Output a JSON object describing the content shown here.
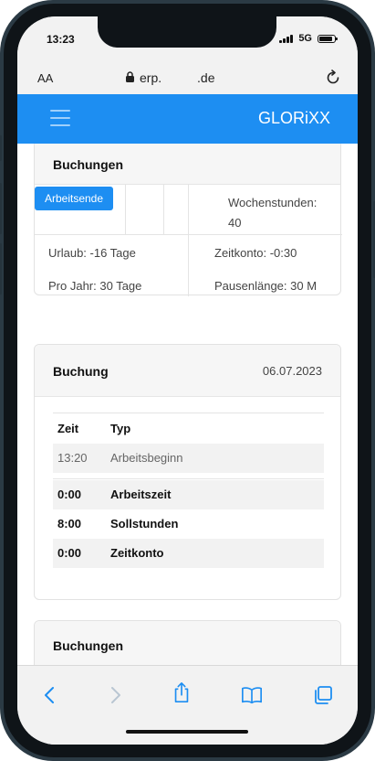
{
  "status": {
    "time": "13:23",
    "network": "5G"
  },
  "browser": {
    "text_size_label": "AA",
    "url": "erp.          .de"
  },
  "app": {
    "brand": "GLORiXX"
  },
  "bookings_card": {
    "title": "Buchungen",
    "action_button": "Arbeitsende",
    "weekly_hours": "Wochenstunden:",
    "weekly_hours_value": "40",
    "vacation": "Urlaub: -16 Tage",
    "time_account": "Zeitkonto: -0:30",
    "per_year": "Pro Jahr: 30 Tage",
    "break_length": "Pausenlänge: 30 M"
  },
  "booking_card": {
    "title": "Buchung",
    "date": "06.07.2023",
    "columns": [
      "Zeit",
      "Typ"
    ],
    "rows": [
      {
        "time": "13:20",
        "type": "Arbeitsbeginn"
      },
      {
        "time": "0:00",
        "type": "Arbeitszeit"
      },
      {
        "time": "8:00",
        "type": "Sollstunden"
      },
      {
        "time": "0:00",
        "type": "Zeitkonto"
      }
    ]
  },
  "bookings_card_2": {
    "title": "Buchungen"
  },
  "toolbar": {
    "icons": [
      "back-icon",
      "forward-icon",
      "share-icon",
      "bookmarks-icon",
      "tabs-icon"
    ]
  },
  "colors": {
    "accent": "#1d8ef2",
    "header_text": "#ffffff"
  }
}
